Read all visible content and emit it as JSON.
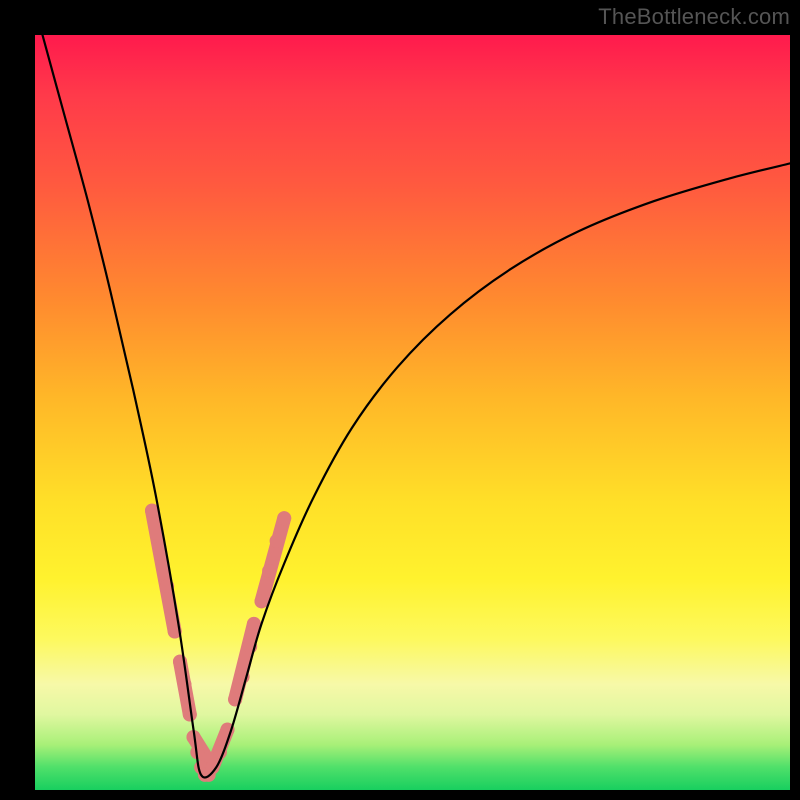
{
  "watermark": "TheBottleneck.com",
  "chart_data": {
    "type": "line",
    "title": "",
    "xlabel": "",
    "ylabel": "",
    "xlim": [
      0,
      100
    ],
    "ylim": [
      0,
      100
    ],
    "grid": false,
    "legend": false,
    "note": "Axes are unlabeled; x and y are treated as 0-100% of the plot area. y encodes bottleneck severity (high=red, low=green). Curve is a V-shape with minimum near x≈22.",
    "series": [
      {
        "name": "bottleneck-curve",
        "color": "#000000",
        "x": [
          1,
          4,
          7,
          10,
          13,
          16,
          19,
          21,
          22,
          24,
          26,
          28,
          30,
          33,
          37,
          42,
          48,
          55,
          63,
          72,
          82,
          92,
          100
        ],
        "y": [
          100,
          89,
          78,
          66,
          53,
          39,
          22,
          8,
          2,
          3,
          8,
          15,
          22,
          30,
          39,
          48,
          56,
          63,
          69,
          74,
          78,
          81,
          83
        ]
      },
      {
        "name": "highlight-markers",
        "color": "#d96a6a",
        "note": "Pink rounded markers clustered near the valley of the curve on both sides.",
        "points": [
          {
            "x": 15.5,
            "y": 37
          },
          {
            "x": 16.5,
            "y": 32
          },
          {
            "x": 17.5,
            "y": 27
          },
          {
            "x": 18.5,
            "y": 21
          },
          {
            "x": 19.2,
            "y": 17
          },
          {
            "x": 19.8,
            "y": 14
          },
          {
            "x": 20.5,
            "y": 10
          },
          {
            "x": 21.0,
            "y": 7
          },
          {
            "x": 21.5,
            "y": 5
          },
          {
            "x": 22.0,
            "y": 3
          },
          {
            "x": 22.5,
            "y": 2
          },
          {
            "x": 23.0,
            "y": 2
          },
          {
            "x": 23.5,
            "y": 3
          },
          {
            "x": 24.5,
            "y": 5
          },
          {
            "x": 25.5,
            "y": 8
          },
          {
            "x": 26.5,
            "y": 12
          },
          {
            "x": 27.5,
            "y": 15
          },
          {
            "x": 28.5,
            "y": 19
          },
          {
            "x": 29.0,
            "y": 22
          },
          {
            "x": 30.0,
            "y": 25
          },
          {
            "x": 31.0,
            "y": 29
          },
          {
            "x": 32.0,
            "y": 33
          },
          {
            "x": 33.0,
            "y": 36
          }
        ]
      }
    ]
  }
}
